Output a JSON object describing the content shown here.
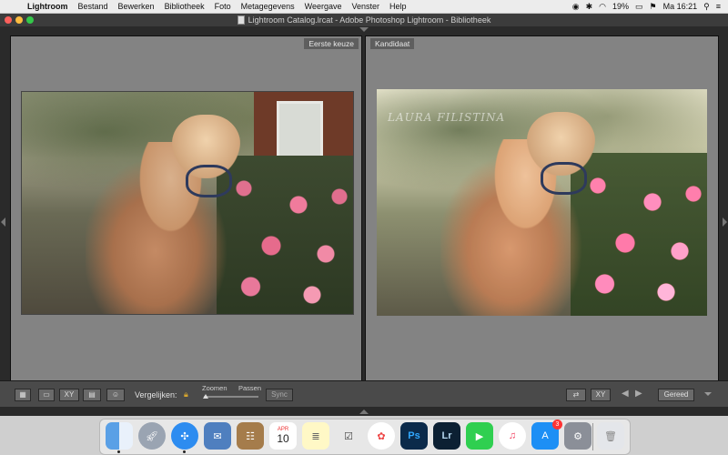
{
  "menubar": {
    "items": [
      "Lightroom",
      "Bestand",
      "Bewerken",
      "Bibliotheek",
      "Foto",
      "Metagegevens",
      "Weergave",
      "Venster",
      "Help"
    ],
    "battery": "19%",
    "clock": "Ma 16:21"
  },
  "window": {
    "title": "Lightroom Catalog.lrcat - Adobe Photoshop Lightroom - Bibliotheek"
  },
  "compare": {
    "left_label": "Eerste keuze",
    "right_label": "Kandidaat",
    "watermark": "LAURA FILISTINA"
  },
  "toolbar": {
    "compare_label": "Vergelijken:",
    "zoom_label": "Zoomen",
    "fit_label": "Passen",
    "sync_label": "Sync",
    "done_label": "Gereed",
    "xy_label": "XY",
    "xy2_label": "XY"
  },
  "dock": {
    "calendar_month": "APR",
    "calendar_day": "10",
    "ps_label": "Ps",
    "lr_label": "Lr",
    "appstore_badge": "3"
  },
  "colors": {
    "menubar": "#ececec",
    "pane_bg": "#838383",
    "lock": "#d7a62e"
  }
}
